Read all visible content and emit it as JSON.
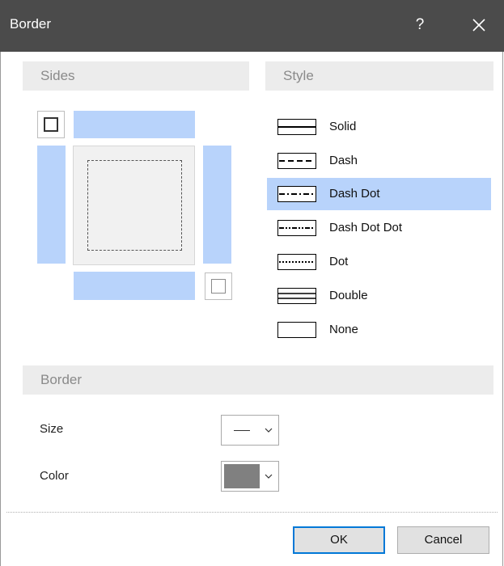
{
  "window": {
    "title": "Border",
    "help_label": "?",
    "close_icon": "close-icon"
  },
  "sections": {
    "sides": "Sides",
    "style": "Style",
    "border": "Border"
  },
  "sides": {
    "selected_sides": [
      "top",
      "left",
      "right",
      "bottom"
    ],
    "all_borders_icon": "all-borders-icon",
    "no_borders_icon": "no-borders-icon"
  },
  "styles": [
    {
      "label": "Solid",
      "icon": "line-solid-icon",
      "selected": false
    },
    {
      "label": "Dash",
      "icon": "line-dash-icon",
      "selected": false
    },
    {
      "label": "Dash Dot",
      "icon": "line-dash-dot-icon",
      "selected": true
    },
    {
      "label": "Dash Dot Dot",
      "icon": "line-dash-dot-dot-icon",
      "selected": false
    },
    {
      "label": "Dot",
      "icon": "line-dot-icon",
      "selected": false
    },
    {
      "label": "Double",
      "icon": "line-double-icon",
      "selected": false
    },
    {
      "label": "None",
      "icon": "line-none-icon",
      "selected": false
    }
  ],
  "border": {
    "size_label": "Size",
    "color_label": "Color",
    "color_value": "#808080"
  },
  "colors": {
    "titlebar": "#4b4b4b",
    "selection": "#b8d3fb",
    "section_header": "#ececec",
    "default_button_border": "#0078d7"
  },
  "buttons": {
    "ok": "OK",
    "cancel": "Cancel"
  }
}
